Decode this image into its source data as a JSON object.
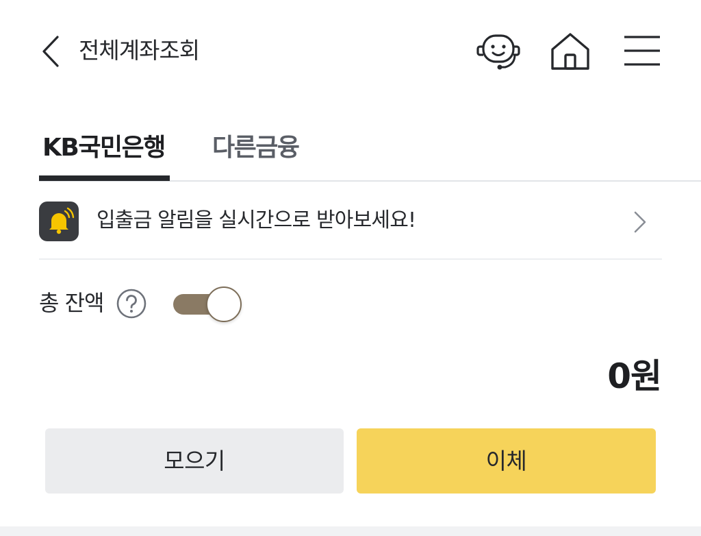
{
  "header": {
    "title": "전체계좌조회",
    "icons": [
      "back-arrow-icon",
      "chatbot-icon",
      "home-icon",
      "menu-icon"
    ]
  },
  "tabs": [
    {
      "label": "KB국민은행",
      "active": true
    },
    {
      "label": "다른금융",
      "active": false
    }
  ],
  "notification": {
    "text": "입출금 알림을 실시간으로 받아보세요!",
    "icon": "bell-icon"
  },
  "balance": {
    "label": "총 잔액",
    "toggle_on": true,
    "amount": "0원"
  },
  "buttons": {
    "gather": "모으기",
    "transfer": "이체"
  },
  "colors": {
    "accent_yellow": "#f6d35a",
    "toggle_brown": "#8a7a64",
    "text_dark": "#26282c",
    "button_gray": "#ebecee"
  }
}
